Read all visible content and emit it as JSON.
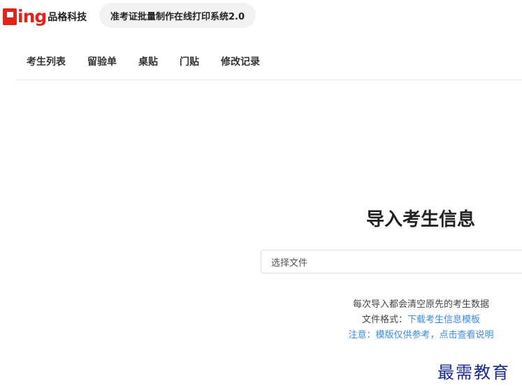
{
  "brand": {
    "logo_latin": "ing",
    "logo_cn": "品格科技"
  },
  "header": {
    "system_title": "准考证批量制作在线打印系统2.0"
  },
  "nav": {
    "items": [
      {
        "label": "考生列表"
      },
      {
        "label": "留验单"
      },
      {
        "label": "桌贴"
      },
      {
        "label": "门贴"
      },
      {
        "label": "修改记录"
      }
    ]
  },
  "import": {
    "title": "导入考生信息",
    "file_placeholder": "选择文件",
    "note_clear": "每次导入都会清空原先的考生数据",
    "format_label": "文件格式：",
    "format_link": "下载考生信息模板",
    "notice_text": "注意：模版仅供参考，点击查看说明"
  },
  "watermark": "最需教育",
  "colors": {
    "brand_red": "#e2231a",
    "link_blue": "#3b8be0",
    "watermark_blue": "#1a2a8a"
  }
}
